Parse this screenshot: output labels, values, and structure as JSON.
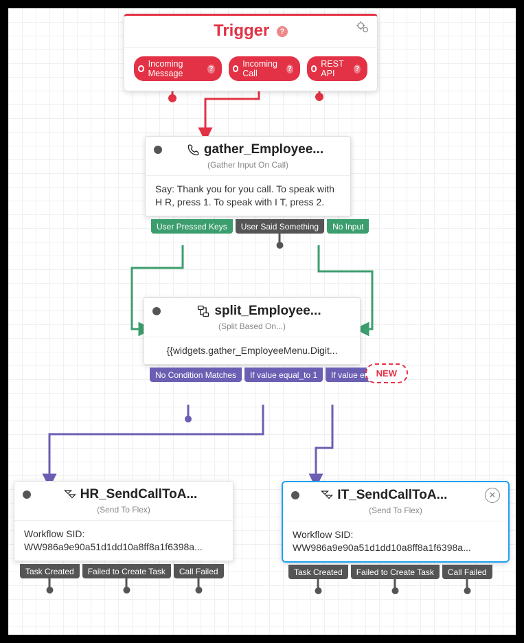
{
  "trigger": {
    "title": "Trigger",
    "ports": [
      "Incoming Message",
      "Incoming Call",
      "REST API"
    ]
  },
  "gather": {
    "title": "gather_Employee...",
    "subtitle": "(Gather Input On Call)",
    "body": "Say: Thank you for you call. To speak with H R, press 1. To speak with I T, press 2.",
    "tabs": [
      "User Pressed Keys",
      "User Said Something",
      "No Input"
    ]
  },
  "split": {
    "title": "split_Employee...",
    "subtitle": "(Split Based On...)",
    "body": "{{widgets.gather_EmployeeMenu.Digit...",
    "tabs": [
      "No Condition Matches",
      "If value equal_to 1",
      "If value equal_to 2"
    ],
    "new_label": "NEW"
  },
  "hr": {
    "title": "HR_SendCallToA...",
    "subtitle": "(Send To Flex)",
    "body_label": "Workflow SID:",
    "body_value": "WW986a9e90a51d1dd10a8ff8a1f6398a...",
    "tabs": [
      "Task Created",
      "Failed to Create Task",
      "Call Failed"
    ]
  },
  "it": {
    "title": "IT_SendCallToA...",
    "subtitle": "(Send To Flex)",
    "body_label": "Workflow SID:",
    "body_value": "WW986a9e90a51d1dd10a8ff8a1f6398a...",
    "tabs": [
      "Task Created",
      "Failed to Create Task",
      "Call Failed"
    ]
  },
  "colors": {
    "red": "#e33245",
    "green": "#3c9e6e",
    "purple": "#6b5fb3",
    "gray": "#555"
  }
}
